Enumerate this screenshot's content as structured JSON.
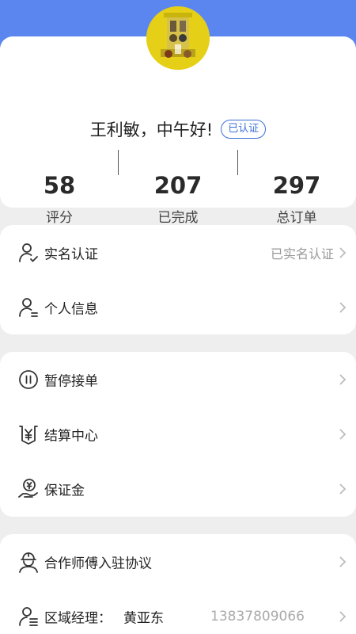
{
  "profile": {
    "greeting": "王利敏，中午好!",
    "badge": "已认证",
    "stats": [
      {
        "value": "58",
        "label": "评分"
      },
      {
        "value": "207",
        "label": "已完成"
      },
      {
        "value": "297",
        "label": "总订单"
      }
    ]
  },
  "account_section": {
    "items": [
      {
        "label": "实名认证",
        "value": "已实名认证",
        "icon": "user-check-icon"
      },
      {
        "label": "个人信息",
        "icon": "user-info-icon"
      }
    ]
  },
  "work_section": {
    "items": [
      {
        "label": "暂停接单",
        "icon": "pause-circle-icon"
      },
      {
        "label": "结算中心",
        "icon": "yen-shield-icon"
      },
      {
        "label": "保证金",
        "icon": "yen-hand-icon"
      }
    ]
  },
  "partner_section": {
    "items": [
      {
        "label": "合作师傅入驻协议",
        "icon": "worker-helmet-icon"
      },
      {
        "label": "区域经理：",
        "name": "黄亚东",
        "phone": "13837809066",
        "icon": "manager-icon"
      }
    ]
  },
  "colors": {
    "header_blue": "#5b86f0",
    "badge_blue": "#3b6fd8",
    "background": "#eeeeee"
  }
}
